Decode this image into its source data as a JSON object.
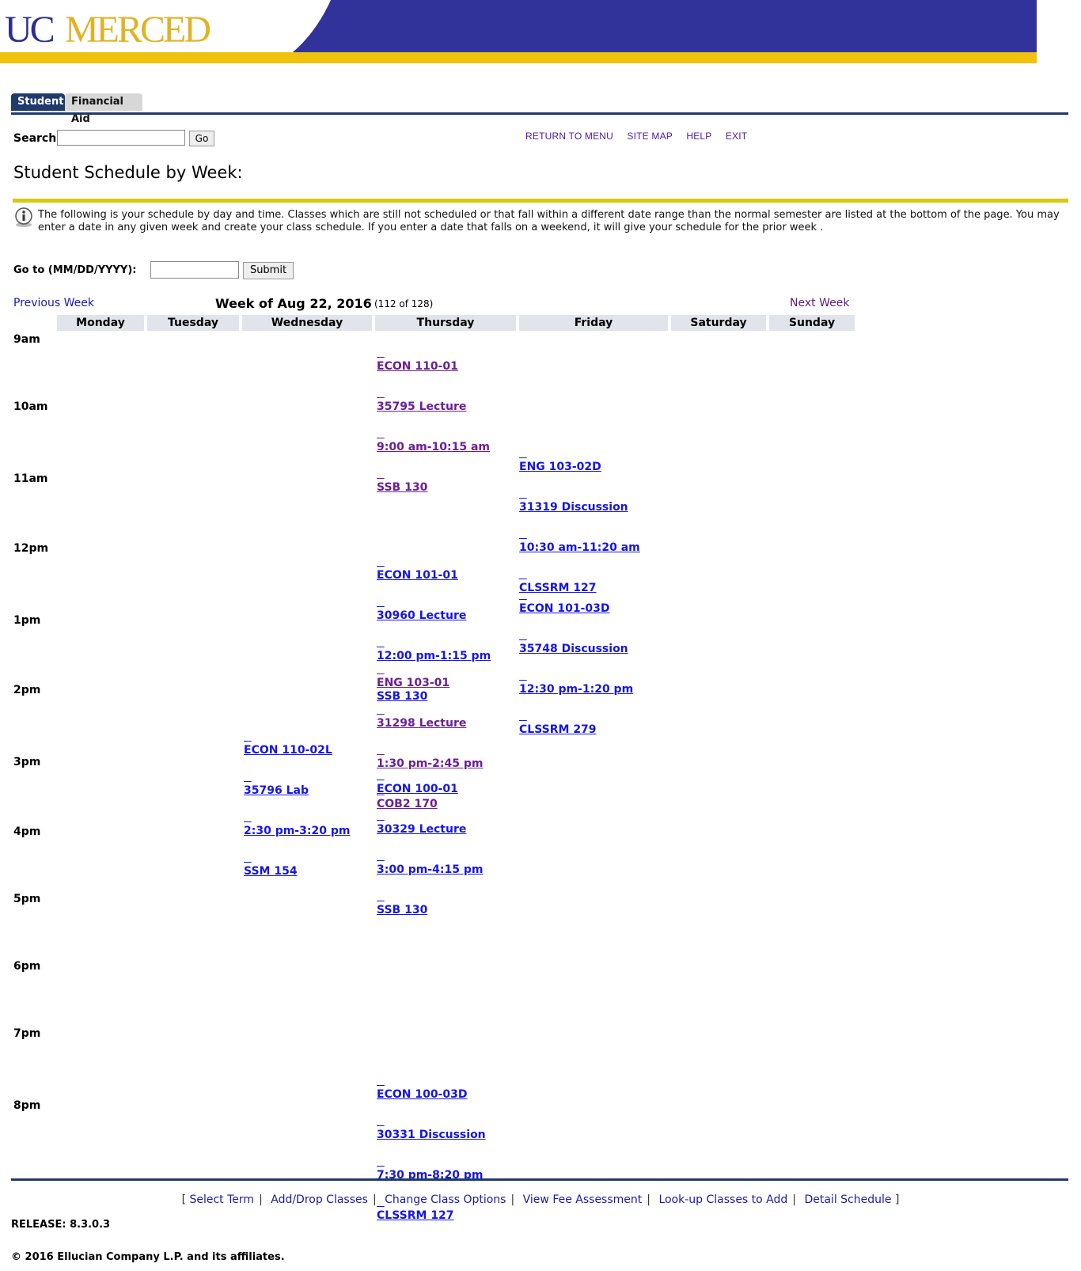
{
  "header": {
    "logo_uc": "UC",
    "logo_merced": "MERCED"
  },
  "tabs": [
    {
      "label": "Student"
    },
    {
      "label": "Financial Aid"
    }
  ],
  "search": {
    "label": "Search",
    "value": "",
    "button": "Go"
  },
  "top_links": [
    "RETURN TO MENU",
    "SITE MAP",
    "HELP",
    "EXIT"
  ],
  "page_title": "Student Schedule by Week:",
  "info_text": "The following is your schedule by day and time. Classes which are still not scheduled or that fall within a different date range than the normal semester are listed at the bottom of the page. You may enter a date in any given week and create your class schedule. If you enter a date that falls on a weekend, it will give your schedule for the prior week .",
  "goto": {
    "label": "Go to (MM/DD/YYYY):",
    "value": "",
    "button": "Submit"
  },
  "week_nav": {
    "previous": "Previous Week",
    "title": "Week of Aug 22, 2016",
    "count": "(112 of 128)",
    "next": "Next Week"
  },
  "days": [
    "Monday",
    "Tuesday",
    "Wednesday",
    "Thursday",
    "Friday",
    "Saturday",
    "Sunday"
  ],
  "hours": [
    "9am",
    "10am",
    "11am",
    "12pm",
    "1pm",
    "2pm",
    "3pm",
    "4pm",
    "5pm",
    "6pm",
    "7pm",
    "8pm"
  ],
  "events": [
    {
      "course": "ECON 110-01",
      "crn_type": "35795 Lecture",
      "time": "9:00 am-10:15 am",
      "room": "SSB 130",
      "day": "Thursday",
      "color": "#6b1f93"
    },
    {
      "course": "ENG 103-02D",
      "crn_type": "31319 Discussion",
      "time": "10:30 am-11:20 am",
      "room": "CLSSRM 127",
      "day": "Friday",
      "color": "#1616e0"
    },
    {
      "course": "ECON 101-01",
      "crn_type": "30960 Lecture",
      "time": "12:00 pm-1:15 pm",
      "room": "SSB 130",
      "day": "Thursday",
      "color": "#1616e0"
    },
    {
      "course": "ECON 101-03D",
      "crn_type": "35748 Discussion",
      "time": "12:30 pm-1:20 pm",
      "room": "CLSSRM 279",
      "day": "Friday",
      "color": "#1616e0"
    },
    {
      "course": "ENG 103-01",
      "crn_type": "31298 Lecture",
      "time": "1:30 pm-2:45 pm",
      "room": "COB2 170",
      "day": "Thursday",
      "color": "#6b1f93"
    },
    {
      "course": "ECON 110-02L",
      "crn_type": "35796 Lab",
      "time": "2:30 pm-3:20 pm",
      "room": "SSM 154",
      "day": "Wednesday",
      "color": "#1616e0"
    },
    {
      "course": "ECON 100-01",
      "crn_type": "30329 Lecture",
      "time": "3:00 pm-4:15 pm",
      "room": "SSB 130",
      "day": "Thursday",
      "color": "#1616e0"
    },
    {
      "course": "ECON 100-03D",
      "crn_type": "30331 Discussion",
      "time": "7:30 pm-8:20 pm",
      "room": "CLSSRM 127",
      "day": "Thursday",
      "color": "#1616e0"
    }
  ],
  "footer_links": [
    "Select Term",
    "Add/Drop Classes",
    "Change Class Options",
    "View Fee Assessment",
    "Look-up Classes to Add",
    "Detail Schedule"
  ],
  "release": "RELEASE: 8.3.0.3",
  "copyright": "© 2016 Ellucian Company L.P. and its affiliates."
}
